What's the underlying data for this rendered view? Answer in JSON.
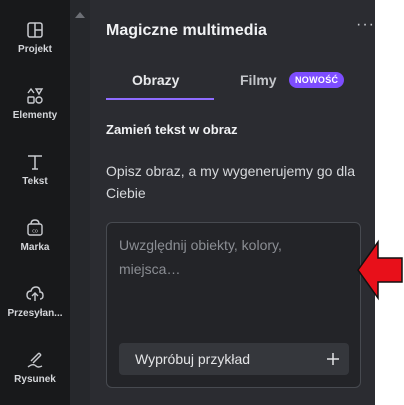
{
  "sidebar": {
    "items": [
      {
        "label": "Projekt",
        "icon": "layout-icon"
      },
      {
        "label": "Elementy",
        "icon": "shapes-icon"
      },
      {
        "label": "Tekst",
        "icon": "text-icon"
      },
      {
        "label": "Marka",
        "icon": "brand-icon"
      },
      {
        "label": "Przesyłan...",
        "icon": "upload-icon"
      },
      {
        "label": "Rysunek",
        "icon": "draw-icon"
      }
    ]
  },
  "panel": {
    "title": "Magiczne multimedia",
    "more": "···",
    "tabs": [
      {
        "label": "Obrazy",
        "active": true
      },
      {
        "label": "Filmy",
        "badge": "NOWOŚĆ"
      }
    ],
    "section_heading": "Zamień tekst w obraz",
    "description": "Opisz obraz, a my wygenerujemy go dla Ciebie",
    "prompt": {
      "placeholder": "Uwzględnij obiekty, kolory, miejsca…",
      "value": ""
    },
    "example_button": "Wypróbuj przykład"
  },
  "colors": {
    "rail_bg": "#18191b",
    "panel_bg": "#2b2c31",
    "accent": "#8f6cff",
    "badge_bg": "#7d4dff",
    "annotation_arrow": "#e8101a"
  }
}
